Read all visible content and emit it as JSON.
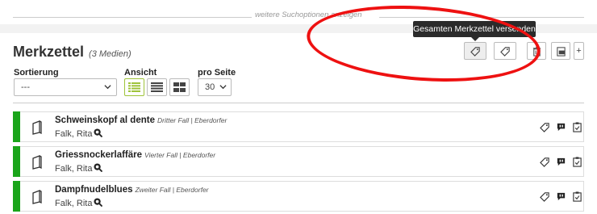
{
  "search": {
    "more_options": "weitere Suchoptionen anzeigen"
  },
  "tooltip": "Gesamten Merkzettel versenden",
  "header": {
    "title": "Merkzettel",
    "count": "(3 Medien)"
  },
  "toolbar": {
    "add_label": "+"
  },
  "sort": {
    "label": "Sortierung",
    "value": "---"
  },
  "view": {
    "label": "Ansicht"
  },
  "per_page": {
    "label": "pro Seite",
    "value": "30"
  },
  "items": [
    {
      "title": "Schweinskopf al dente",
      "meta": "Dritter Fall | Eberdorfer",
      "author": "Falk, Rita",
      "status_color": "#1aa51a"
    },
    {
      "title": "Griessnockerlaffäre",
      "meta": "Vierter Fall | Eberdorfer",
      "author": "Falk, Rita",
      "status_color": "#1aa51a"
    },
    {
      "title": "Dampfnudelblues",
      "meta": "Zweiter Fall | Eberdorfer",
      "author": "Falk, Rita",
      "status_color": "#1aa51a"
    }
  ],
  "colors": {
    "accent_green": "#1aa51a",
    "highlight_circle": "#e11111",
    "view_active": "#9ec33a"
  }
}
